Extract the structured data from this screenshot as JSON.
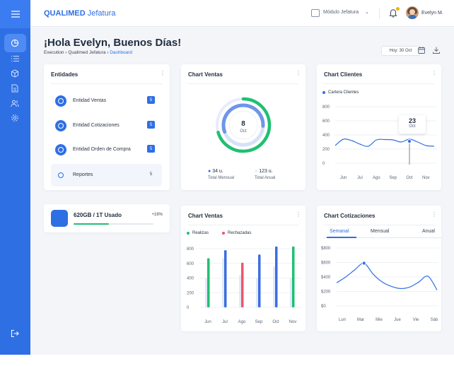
{
  "header": {
    "brand_bold": "QUALIMED",
    "brand_light": "Jefatura",
    "module_label": "Módulo Jefatura",
    "user_name": "Evelyn M."
  },
  "page": {
    "greeting": "¡Hola Evelyn, Buenos Días!",
    "breadcrumb": [
      "Execution",
      "Qualimed Jefatura",
      "Dashboard"
    ],
    "date_button": "Hoy: 30 Oct"
  },
  "entidades": {
    "title": "Entidades",
    "items": [
      {
        "label": "Entidad Ventas",
        "count": "5"
      },
      {
        "label": "Entidad Cotizaciones",
        "count": "5"
      },
      {
        "label": "Entidad Orden de Compra",
        "count": "5"
      },
      {
        "label": "Reportes",
        "count": "5"
      }
    ]
  },
  "storage": {
    "label": "620GB / 1T Usado",
    "change": "+16%",
    "progress": 0.44
  },
  "chart_ventas_donut": {
    "title": "Chart Ventas",
    "center_value": "8",
    "center_label": "Oct",
    "stats": [
      {
        "value": "34 u.",
        "label": "Total Mensual",
        "color": "#2f6fe4"
      },
      {
        "value": "123 u.",
        "label": "Total Anual",
        "color": "#dfe6f5"
      }
    ]
  },
  "chart_clientes": {
    "title": "Chart Clientes",
    "legend": "Cartera Clientes",
    "tooltip_value": "23",
    "tooltip_label": "Oct"
  },
  "chart_ventas_bars": {
    "title": "Chart Ventas",
    "legend": [
      {
        "name": "Realizas",
        "color": "#1fc073"
      },
      {
        "name": "Rechazadas",
        "color": "#f2546b"
      }
    ]
  },
  "chart_cotizaciones": {
    "title": "Chart Cotizaciones",
    "tabs": [
      "Semanal",
      "Mensual",
      "Anual"
    ],
    "active_tab": "Semanal"
  },
  "chart_data": [
    {
      "type": "pie",
      "title": "Chart Ventas",
      "center_text": "8 Oct",
      "values": [
        34,
        123
      ],
      "labels": [
        "Total Mensual",
        "Total Anual"
      ]
    },
    {
      "type": "line",
      "title": "Chart Clientes",
      "categories": [
        "Jun",
        "Jul",
        "Ago",
        "Sep",
        "Oct",
        "Nov"
      ],
      "x": [
        0,
        0.5,
        1,
        1.5,
        2,
        2.5,
        3,
        3.5,
        4,
        4.5,
        5,
        5.5,
        6
      ],
      "y": [
        250,
        340,
        320,
        270,
        240,
        330,
        335,
        330,
        300,
        340,
        300,
        250,
        240
      ],
      "series": [
        {
          "name": "Cartera Clientes"
        }
      ],
      "ylim": [
        0,
        800
      ],
      "yticks": [
        0,
        200,
        400,
        600,
        800
      ],
      "highlight": {
        "x": 4.5,
        "y": 310,
        "label": "23",
        "sublabel": "Oct"
      }
    },
    {
      "type": "bar",
      "title": "Chart Ventas",
      "categories": [
        "Jun",
        "Jul",
        "Ago",
        "Sep",
        "Oct",
        "Nov"
      ],
      "series": [
        {
          "name": "Realizas",
          "values": [
            670,
            780,
            0,
            720,
            830,
            830
          ]
        },
        {
          "name": "Rechazadas",
          "values": [
            0,
            0,
            610,
            0,
            0,
            0
          ]
        }
      ],
      "background_values": [
        400,
        670,
        440,
        400,
        560,
        400
      ],
      "bar_colors": [
        "#1fc073",
        "#3b6ee0",
        "#f2546b",
        "#3b6ee0",
        "#3b6ee0",
        "#1fc073"
      ],
      "ylim": [
        0,
        800
      ],
      "yticks": [
        0,
        200,
        400,
        600,
        800
      ]
    },
    {
      "type": "line",
      "title": "Chart Cotizaciones",
      "categories": [
        "Lun",
        "Mar",
        "Mie",
        "Jue",
        "Vie",
        "Sáb"
      ],
      "x": [
        0,
        0.5,
        1,
        1.5,
        2,
        2.5,
        3,
        3.5,
        4,
        4.5,
        5,
        5.5
      ],
      "y": [
        320,
        400,
        500,
        590,
        440,
        330,
        270,
        240,
        260,
        330,
        410,
        220
      ],
      "ylim": [
        0,
        800
      ],
      "yticks": [
        "$0",
        "$200",
        "$400",
        "$600",
        "$800"
      ],
      "highlight": {
        "x": 1.5,
        "y": 590
      }
    }
  ]
}
